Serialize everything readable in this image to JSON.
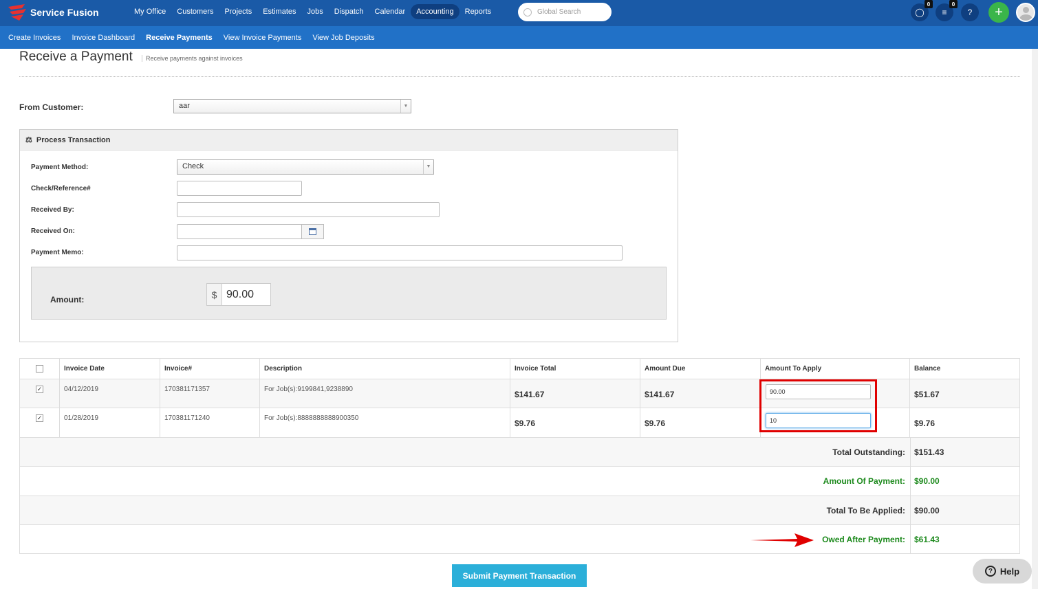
{
  "brand": {
    "name": "Service Fusion",
    "accent": "#1a5aa7",
    "subnav_color": "#2171c7",
    "logo_color": "#e8312f"
  },
  "nav": {
    "items": [
      "My Office",
      "Customers",
      "Projects",
      "Estimates",
      "Jobs",
      "Dispatch",
      "Calendar",
      "Accounting",
      "Reports"
    ],
    "active": "Accounting",
    "search_placeholder": "Global Search",
    "chat_badge": "0",
    "tasks_badge": "0",
    "help_glyph": "?",
    "plus_glyph": "+"
  },
  "subnav": {
    "items": [
      "Create Invoices",
      "Invoice Dashboard",
      "Receive Payments",
      "View Invoice Payments",
      "View Job Deposits"
    ],
    "active": "Receive Payments"
  },
  "page": {
    "title": "Receive a Payment",
    "subtitle": "Receive payments against invoices"
  },
  "customer": {
    "label": "From Customer:",
    "value": "aar"
  },
  "process": {
    "title": "Process Transaction",
    "payment_method_label": "Payment Method:",
    "payment_method_value": "Check",
    "check_ref_label": "Check/Reference#",
    "check_ref_value": "",
    "received_by_label": "Received By:",
    "received_by_value": "",
    "received_on_label": "Received On:",
    "received_on_value": "",
    "memo_label": "Payment Memo:",
    "memo_value": "",
    "amount_label": "Amount:",
    "currency": "$",
    "amount_value": "90.00"
  },
  "table": {
    "headers": [
      "Invoice Date",
      "Invoice#",
      "Description",
      "Invoice Total",
      "Amount Due",
      "Amount To Apply",
      "Balance"
    ],
    "rows": [
      {
        "checked": "✓",
        "date": "04/12/2019",
        "invoice": "170381171357",
        "description": "For Job(s):9199841,9238890",
        "total": "$141.67",
        "due": "$141.67",
        "apply": "90.00",
        "balance": "$51.67"
      },
      {
        "checked": "✓",
        "date": "01/28/2019",
        "invoice": "170381171240",
        "description": "For Job(s):8888888888900350",
        "total": "$9.76",
        "due": "$9.76",
        "apply": "10",
        "balance": "$9.76"
      }
    ]
  },
  "summary": {
    "total_outstanding_label": "Total Outstanding:",
    "total_outstanding": "$151.43",
    "amount_of_payment_label": "Amount Of Payment:",
    "amount_of_payment": "$90.00",
    "total_to_apply_label": "Total To Be Applied:",
    "total_to_apply": "$90.00",
    "owed_after_label": "Owed After Payment:",
    "owed_after": "$61.43"
  },
  "submit_label": "Submit Payment Transaction",
  "help_label": "Help"
}
